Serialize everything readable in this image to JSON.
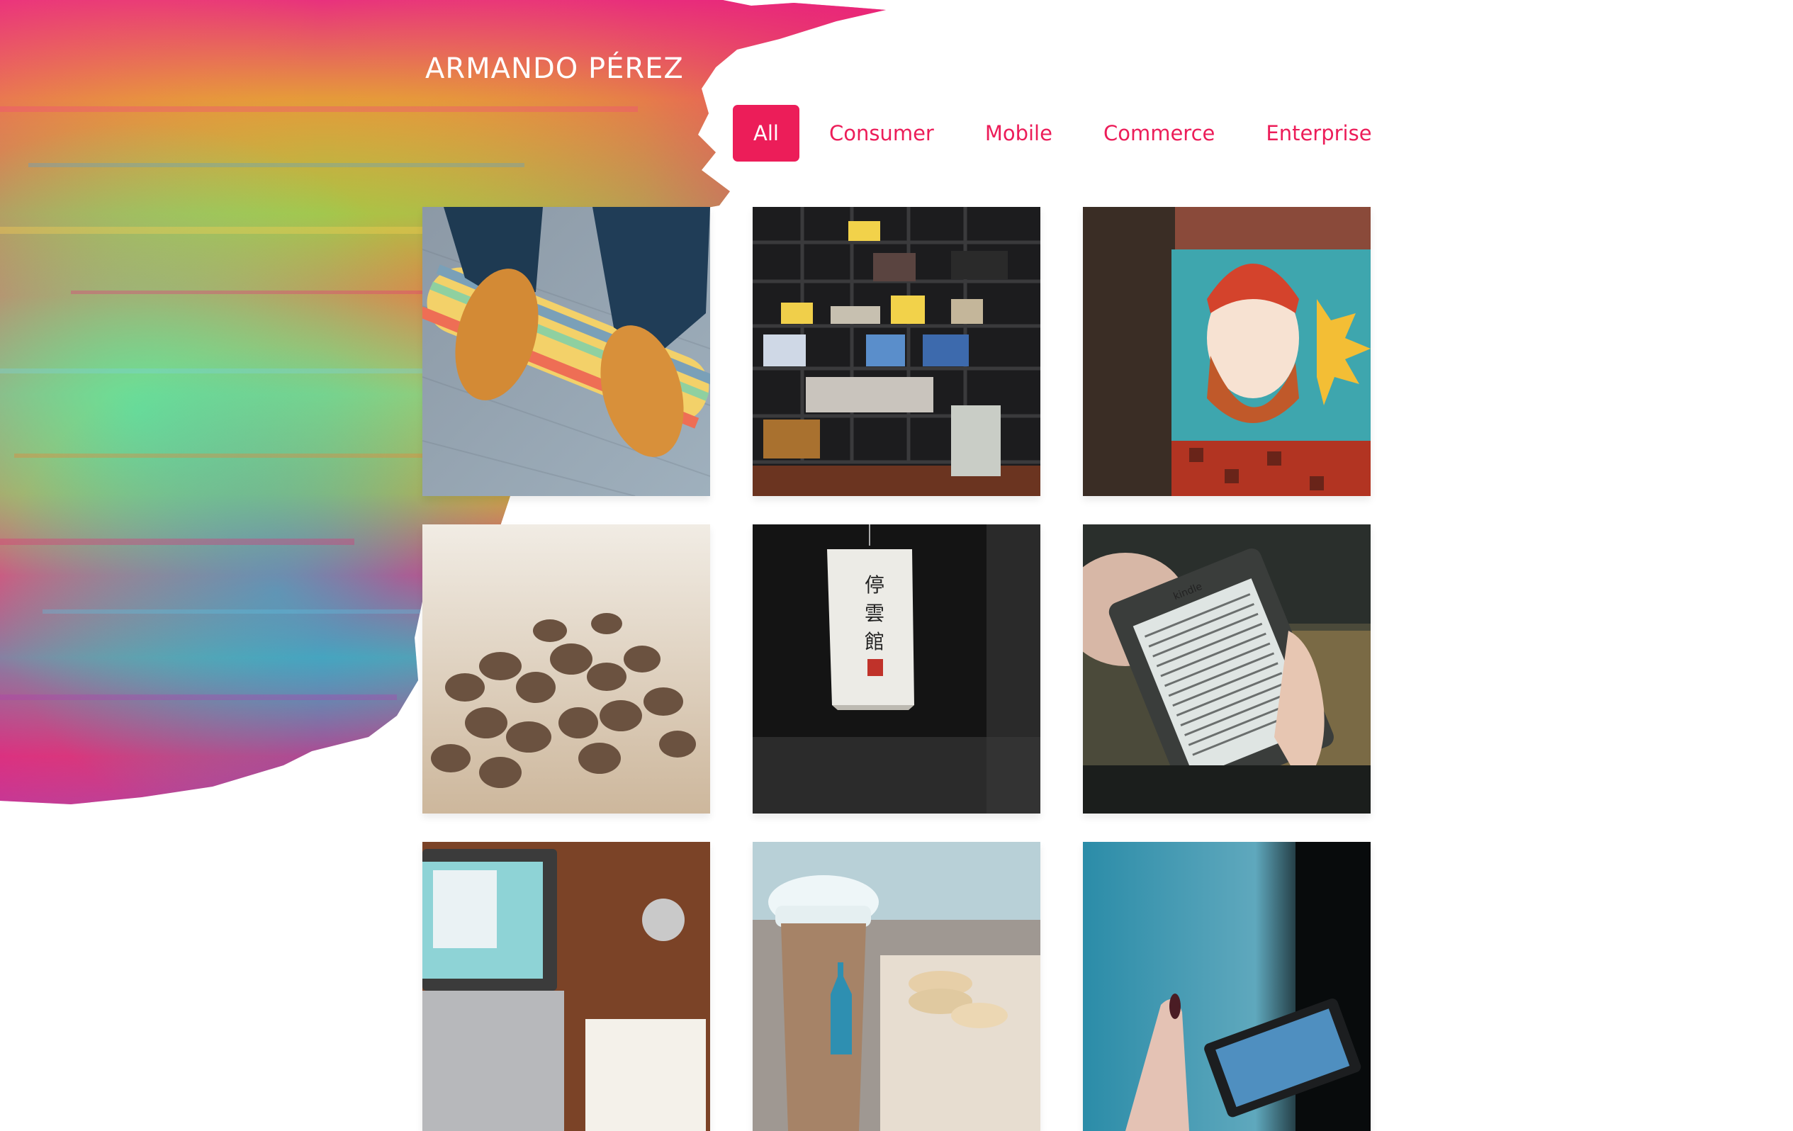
{
  "header": {
    "title": "ARMANDO PÉREZ"
  },
  "filters": {
    "active": "All",
    "items": [
      {
        "label": "All",
        "active": true
      },
      {
        "label": "Consumer",
        "active": false
      },
      {
        "label": "Mobile",
        "active": false
      },
      {
        "label": "Commerce",
        "active": false
      },
      {
        "label": "Enterprise",
        "active": false
      }
    ]
  },
  "theme": {
    "accent": "#ec1d59",
    "background": "#ffffff",
    "title_color": "#ffffff"
  },
  "gallery": {
    "items": [
      {
        "subject": "shoes-on-skateboard"
      },
      {
        "subject": "bookshelf"
      },
      {
        "subject": "bearded-man-mural"
      },
      {
        "subject": "coffee-beans"
      },
      {
        "subject": "paper-lantern",
        "lantern_text": "停雲館"
      },
      {
        "subject": "kindle-ereader",
        "device_label": "kindle"
      },
      {
        "subject": "laptop-on-desk"
      },
      {
        "subject": "coffee-cup-macarons"
      },
      {
        "subject": "hand-holding-phone"
      }
    ]
  }
}
